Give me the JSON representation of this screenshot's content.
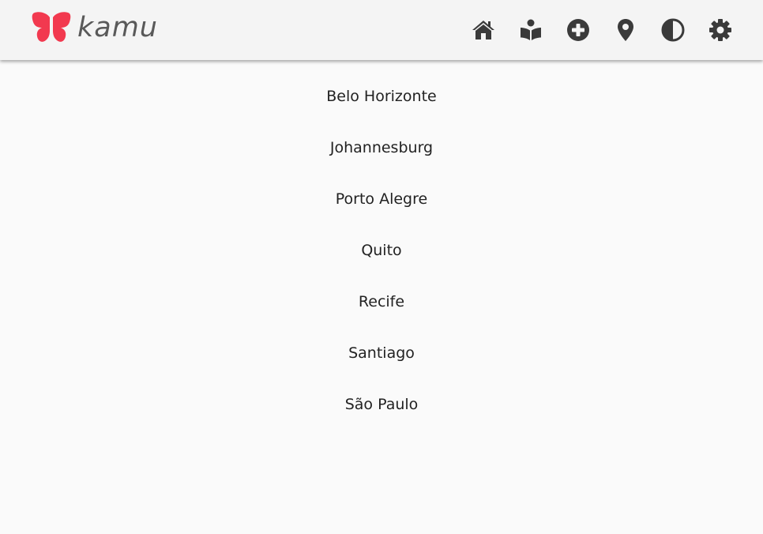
{
  "header": {
    "logo_text": "kamu",
    "brand_color": "#f2394f",
    "icon_color": "#3a3a3a",
    "nav": [
      {
        "name": "home-icon"
      },
      {
        "name": "reader-icon"
      },
      {
        "name": "add-icon"
      },
      {
        "name": "location-pin-icon"
      },
      {
        "name": "contrast-icon"
      },
      {
        "name": "gear-icon"
      }
    ]
  },
  "cities": [
    {
      "label": "Belo Horizonte"
    },
    {
      "label": "Johannesburg"
    },
    {
      "label": "Porto Alegre"
    },
    {
      "label": "Quito"
    },
    {
      "label": "Recife"
    },
    {
      "label": "Santiago"
    },
    {
      "label": "São Paulo"
    }
  ]
}
